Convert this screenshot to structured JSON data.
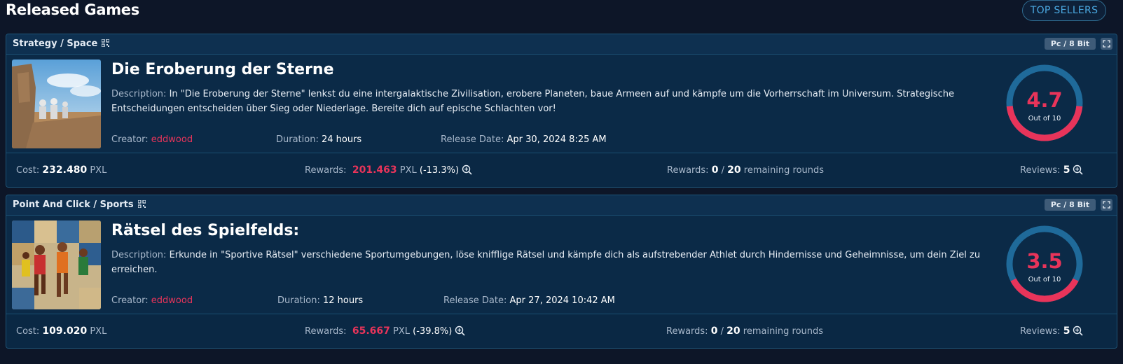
{
  "page": {
    "title": "Released Games",
    "top_sellers_label": "TOP SELLERS"
  },
  "labels": {
    "description": "Description:",
    "creator": "Creator:",
    "duration": "Duration:",
    "release_date": "Release Date:",
    "cost": "Cost:",
    "rewards": "Rewards:",
    "reviews": "Reviews:",
    "out_of": "Out of 10",
    "currency": "PXL",
    "remaining": "remaining rounds",
    "slash": "/"
  },
  "colors": {
    "accent_red": "#e8345a",
    "gauge_track": "#1f6a9a",
    "background": "#0d1628"
  },
  "games": [
    {
      "genre": "Strategy / Space",
      "platform": "Pc / 8 Bit",
      "title": "Die Eroberung der Sterne",
      "description": "In \"Die Eroberung der Sterne\" lenkst du eine intergalaktische Zivilisation, erobere Planeten, baue Armeen auf und kämpfe um die Vorherrschaft im Universum. Strategische Entscheidungen entscheiden über Sieg oder Niederlage. Bereite dich auf epische Schlachten vor!",
      "creator": "eddwood",
      "duration": "24 hours",
      "release_date": "Apr 30, 2024 8:25 AM",
      "rating": "4.7",
      "rating_value": 4.7,
      "cost": "232.480",
      "rewards": "201.463",
      "rewards_pct": "(-13.3%)",
      "rounds_done": "0",
      "rounds_total": "20",
      "reviews": "5"
    },
    {
      "genre": "Point And Click / Sports",
      "platform": "Pc / 8 Bit",
      "title": "Rätsel des Spielfelds:",
      "description": "Erkunde in \"Sportive Rätsel\" verschiedene Sportumgebungen, löse knifflige Rätsel und kämpfe dich als aufstrebender Athlet durch Hindernisse und Geheimnisse, um dein Ziel zu erreichen.",
      "creator": "eddwood",
      "duration": "12 hours",
      "release_date": "Apr 27, 2024 10:42 AM",
      "rating": "3.5",
      "rating_value": 3.5,
      "cost": "109.020",
      "rewards": "65.667",
      "rewards_pct": "(-39.8%)",
      "rounds_done": "0",
      "rounds_total": "20",
      "reviews": "5"
    }
  ]
}
